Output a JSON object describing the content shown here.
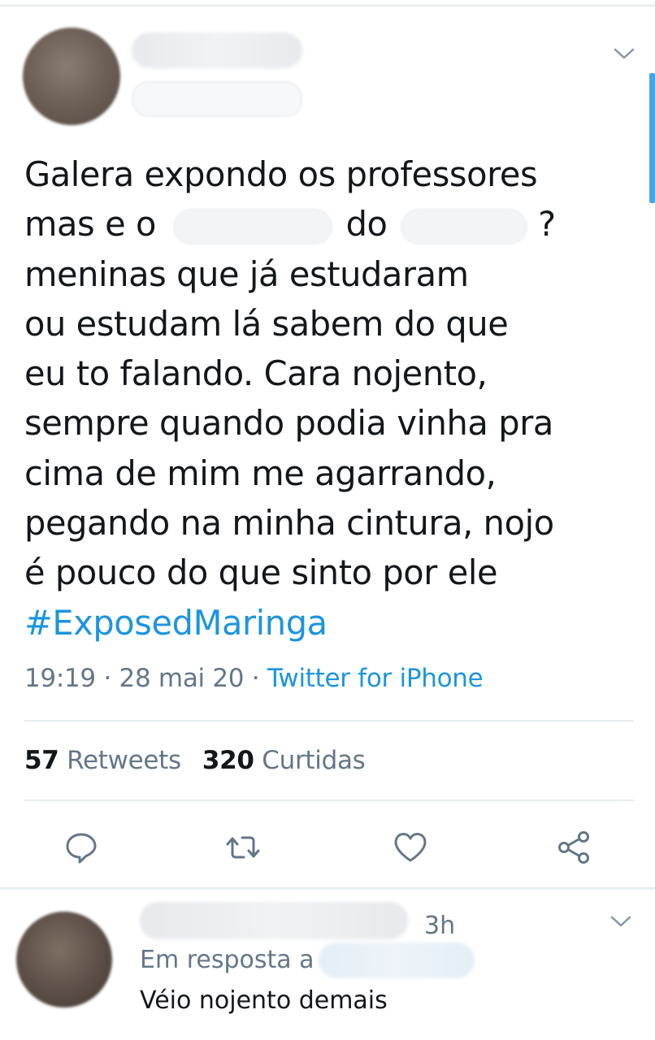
{
  "tweet": {
    "text_lines": [
      {
        "segments": [
          "Galera expondo os professores"
        ]
      },
      {
        "segments": [
          "mas e o",
          "do",
          "?"
        ]
      },
      {
        "segments": [
          "meninas que já estudaram"
        ]
      },
      {
        "segments": [
          "ou estudam lá sabem do que"
        ]
      },
      {
        "segments": [
          "eu to falando. Cara nojento,"
        ]
      },
      {
        "segments": [
          "sempre quando podia vinha pra"
        ]
      },
      {
        "segments": [
          "cima de mim me agarrando,"
        ]
      },
      {
        "segments": [
          "pegando na minha cintura, nojo"
        ]
      },
      {
        "segments": [
          "é pouco do que sinto por ele"
        ]
      }
    ],
    "hashtag": "#ExposedMaringa",
    "time": "19:19",
    "separator": " · ",
    "date": "28 mai 20",
    "source": "Twitter for iPhone"
  },
  "stats": {
    "retweets_count": "57",
    "retweets_label": "Retweets",
    "likes_count": "320",
    "likes_label": "Curtidas"
  },
  "actions": {
    "icons": [
      "reply-icon",
      "retweet-icon",
      "like-icon",
      "share-icon"
    ]
  },
  "reply": {
    "time": "3h",
    "in_reply_to": "Em resposta a",
    "text": "Véio nojento demais"
  },
  "colors": {
    "link": "#1b95e0",
    "secondary_text": "#657786",
    "primary_text": "#14171a",
    "divider": "#e6ecf0",
    "scrollbar": "#4aa4e8"
  }
}
